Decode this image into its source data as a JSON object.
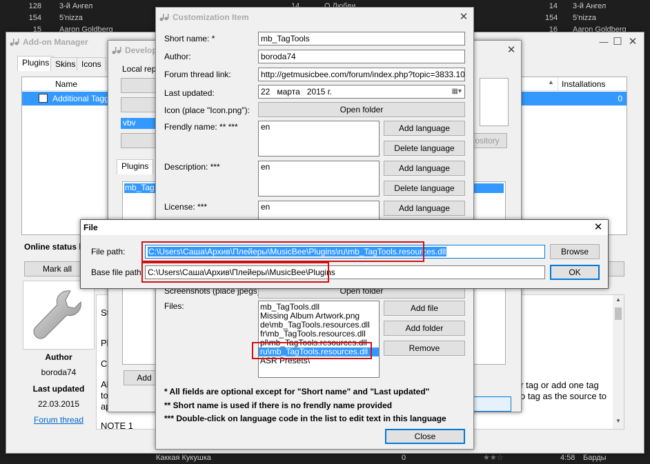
{
  "background": {
    "left_rows": [
      {
        "n": "128",
        "title": "3-й Ангел",
        "dur": "14"
      },
      {
        "n": "154",
        "title": "5'nizza",
        "dur": ""
      },
      {
        "n": "15",
        "title": "Aaron Goldberg",
        "dur": ""
      }
    ],
    "mid_rows": [
      {
        "title": "О Любви",
        "n": "14"
      },
      {
        "title": "",
        "n": "154"
      },
      {
        "title": "",
        "n": "16"
      }
    ],
    "right_rows": [
      "3-й Ангел",
      "5'nizza",
      "Aaron Goldberg"
    ],
    "bottom_row": {
      "title": "Каккая Кукушка",
      "n": "0",
      "time": "4:58",
      "artist": "Барды"
    }
  },
  "addon_manager": {
    "title": "Add-on Manager",
    "tabs": [
      "Plugins",
      "Skins",
      "Icons"
    ],
    "col_name": "Name",
    "col_installations": "Installations",
    "row_name": "Additional Taggin",
    "row_installs": "0",
    "online_status": "Online status le",
    "mark_all": "Mark all",
    "author_label": "Author",
    "author": "boroda74",
    "last_updated_label": "Last updated",
    "last_updated": "22.03.2015",
    "forum_link": "Forum thread",
    "desc_lines": [
      "St",
      "Pl",
      "Co",
      "Al",
      "to",
      "ap",
      "NOTE 1"
    ],
    "right_desc": [
      "er tag or add one tag",
      "o tag as the source to"
    ],
    "repository_btn": "ository"
  },
  "developer": {
    "title": "Develop",
    "local_repo": "Local repo",
    "selected_item": "vbv",
    "tabs": [
      "Plugins"
    ],
    "list_item": "mb_Tag",
    "add_btn": "Add"
  },
  "customization": {
    "title": "Customization Item",
    "short_name_label": "Short name: *",
    "short_name": "mb_TagTools",
    "author_label": "Author:",
    "author": "boroda74",
    "forum_label": "Forum thread link:",
    "forum": "http://getmusicbee.com/forum/index.php?topic=3833.10000",
    "updated_label": "Last updated:",
    "updated_day": "22",
    "updated_month": "марта",
    "updated_year": "2015 г.",
    "icon_label": "Icon (place \"Icon.png\"):",
    "open_folder": "Open folder",
    "friendly_label": "Frendly name: ** ***",
    "friendly_value": "en",
    "add_language": "Add language",
    "delete_language": "Delete language",
    "description_label": "Description: ***",
    "description_value": "en",
    "license_label": "License: ***",
    "license_value": "en",
    "screenshots_label": "Screenshots (place jpegs):",
    "files_label": "Files:",
    "files": [
      "mb_TagTools.dll",
      "Missing Album Artwork.png",
      "de\\mb_TagTools.resources.dll",
      "fr\\mb_TagTools.resources.dll",
      "pl\\mb_TagTools.resources.dll",
      "ru\\mb_TagTools.resources.dll",
      "ASR Presets\\"
    ],
    "add_file": "Add file",
    "add_folder": "Add folder",
    "remove": "Remove",
    "note1": "* All fields are optional except for \"Short name\" and \"Last updated\"",
    "note2": "** Short name is used if there is no frendly name provided",
    "note3": "*** Double-click on language code in the list to edit text in this language",
    "close": "Close"
  },
  "file_dialog": {
    "title": "File",
    "file_path_label": "File path:",
    "file_path": "C:\\Users\\Саша\\Архив\\Плейеры\\MusicBee\\Plugins\\ru\\mb_TagTools.resources.dll",
    "base_path_label": "Base file path:",
    "base_path": "C:\\Users\\Саша\\Архив\\Плейеры\\MusicBee\\Plugins",
    "browse": "Browse",
    "ok": "OK"
  }
}
